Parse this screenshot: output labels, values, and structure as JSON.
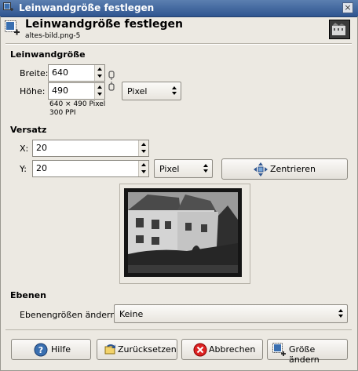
{
  "window": {
    "title": "Leinwandgröße festlegen",
    "close_label": "×"
  },
  "header": {
    "title": "Leinwandgröße festlegen",
    "subtitle": "altes-bild.png-5"
  },
  "canvas_size": {
    "section_label": "Leinwandgröße",
    "width_label": "Breite:",
    "width_value": "640",
    "height_label": "Höhe:",
    "height_value": "490",
    "unit_value": "Pixel",
    "info_size": "640 × 490 Pixel",
    "info_ppi": "300 PPI"
  },
  "offset": {
    "section_label": "Versatz",
    "x_label": "X:",
    "x_value": "20",
    "y_label": "Y:",
    "y_value": "20",
    "unit_value": "Pixel",
    "center_label": "Zentrieren"
  },
  "layers": {
    "section_label": "Ebenen",
    "resize_label": "Ebenengrößen ändern",
    "resize_value": "Keine"
  },
  "footer": {
    "help_label": "Hilfe",
    "reset_label": "Zurücksetzen",
    "cancel_label": "Abbrechen",
    "resize_label": "Größe ändern"
  },
  "icons": {
    "title": "canvas-size-icon",
    "header": "canvas-size-icon",
    "thumbnail": "image-thumbnail-icon",
    "chain": "chain-link-icon",
    "center": "center-arrows-icon",
    "help": "help-icon",
    "reset": "reset-icon",
    "cancel": "cancel-icon",
    "resize": "resize-icon"
  }
}
